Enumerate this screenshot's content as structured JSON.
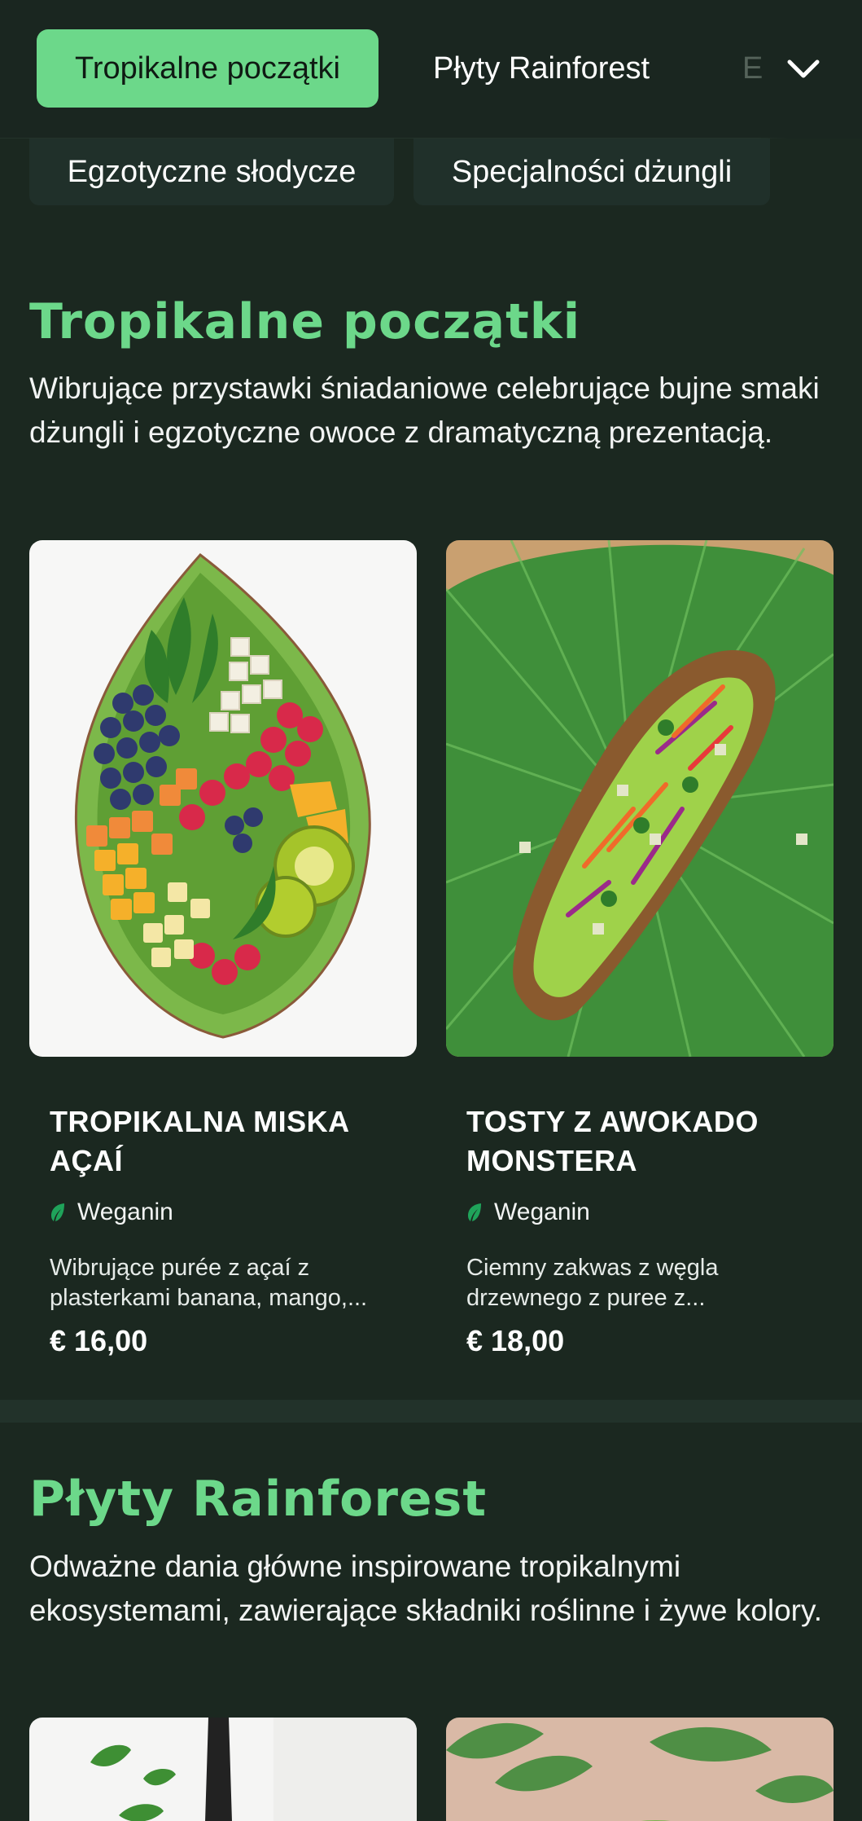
{
  "nav": {
    "tabs": [
      {
        "label": "Tropikalne początki",
        "active": true
      },
      {
        "label": "Płyty Rainforest",
        "active": false
      },
      {
        "label": "E",
        "active": false
      }
    ],
    "subtabs": [
      {
        "label": "Egzotyczne słodycze"
      },
      {
        "label": "Specjalności dżungli"
      }
    ],
    "expand_icon": "chevron-down-icon"
  },
  "sections": [
    {
      "title": "Tropikalne początki",
      "description": "Wibrujące przystawki śniadaniowe celebrujące bujne smaki dżungli i egzotyczne owoce z dramatyczną prezentacją.",
      "items": [
        {
          "name": "TROPIKALNA MISKA AÇAÍ",
          "diet": "Weganin",
          "description": "Wibrujące purée z açaí z plasterkami banana, mango,...",
          "price": "€ 16,00"
        },
        {
          "name": "TOSTY Z AWOKADO MONSTERA",
          "diet": "Weganin",
          "description": "Ciemny zakwas z węgla drzewnego z puree z...",
          "price": "€ 18,00"
        }
      ]
    },
    {
      "title": "Płyty Rainforest",
      "description": "Odważne dania główne inspirowane tropikalnymi ekosystemami, zawierające składniki roślinne i żywe kolory."
    }
  ],
  "colors": {
    "background": "#1b2820",
    "accent": "#6cd88a",
    "leaf_icon": "#1fa35a"
  }
}
